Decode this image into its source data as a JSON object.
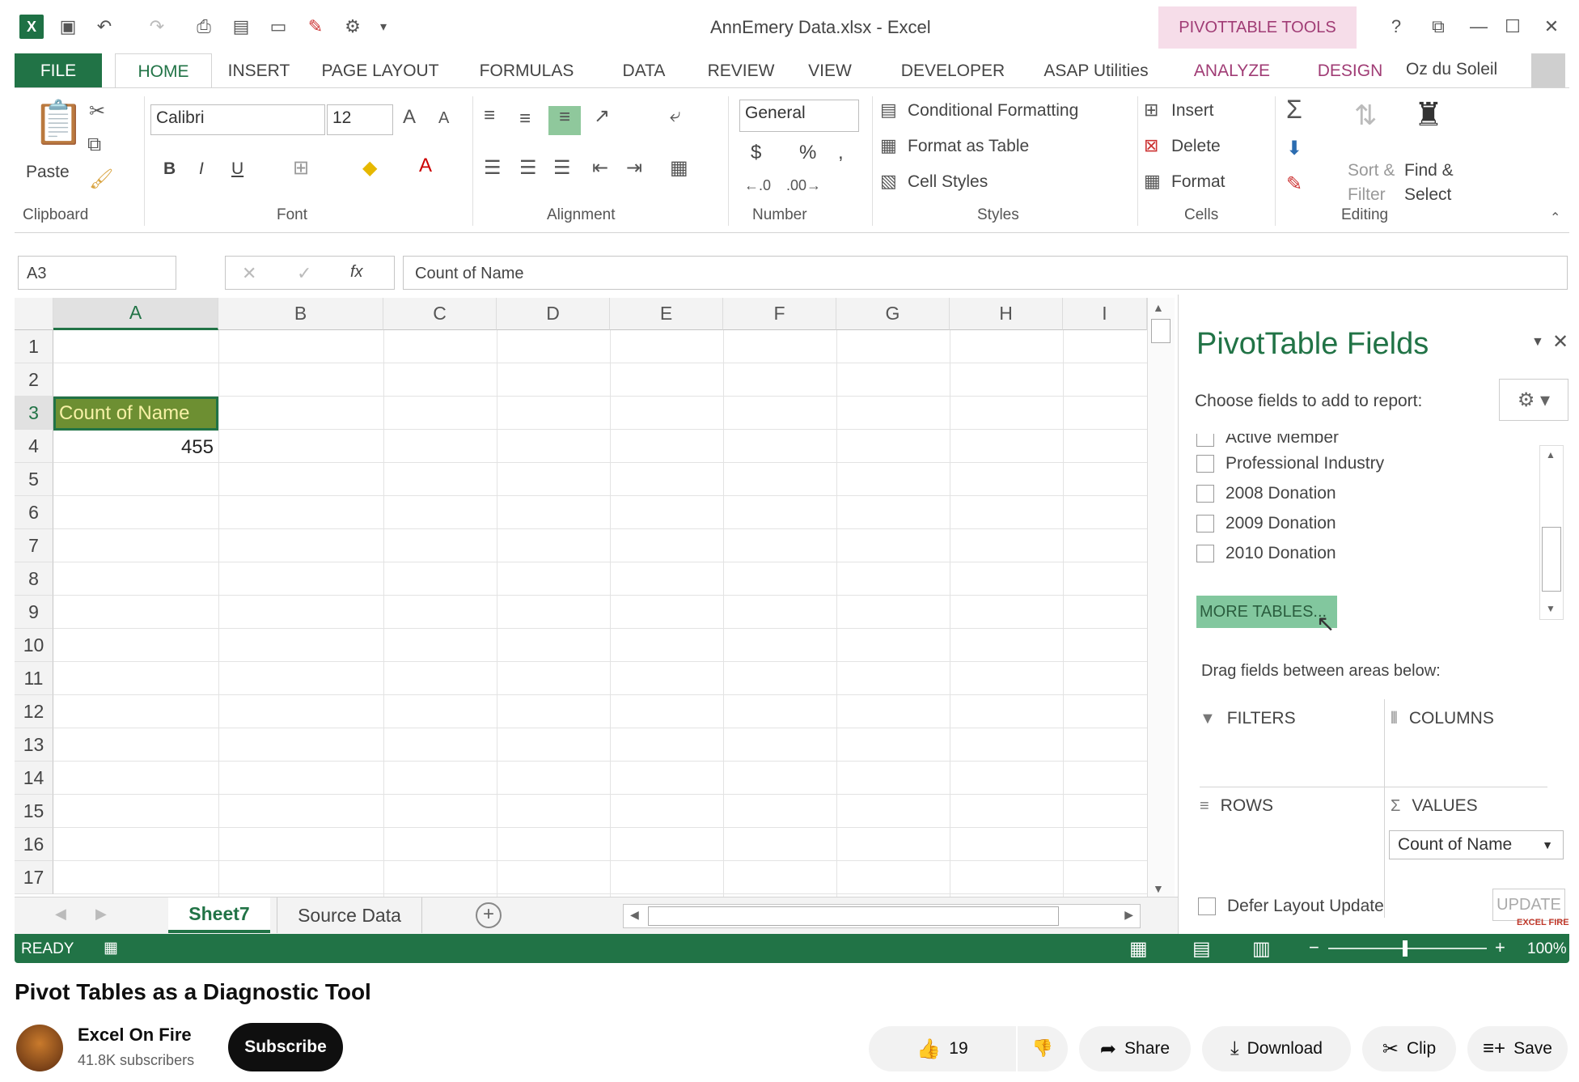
{
  "excel": {
    "window_title": "AnnEmery Data.xlsx - Excel",
    "contextual_tab_group": "PIVOTTABLE TOOLS",
    "help": "?",
    "tabs": [
      "FILE",
      "HOME",
      "INSERT",
      "PAGE LAYOUT",
      "FORMULAS",
      "DATA",
      "REVIEW",
      "VIEW",
      "DEVELOPER",
      "ASAP Utilities",
      "ANALYZE",
      "DESIGN"
    ],
    "user_name": "Oz du Soleil",
    "ribbon": {
      "clipboard": {
        "paste": "Paste",
        "label": "Clipboard"
      },
      "font": {
        "name": "Calibri",
        "size": "12",
        "bold": "B",
        "italic": "I",
        "underline": "U",
        "label": "Font"
      },
      "alignment": {
        "label": "Alignment"
      },
      "number": {
        "format": "General",
        "currency": "$",
        "percent": "%",
        "comma": ",",
        "label": "Number"
      },
      "styles": {
        "conditional_formatting": "Conditional Formatting",
        "format_as_table": "Format as Table",
        "cell_styles": "Cell Styles",
        "label": "Styles"
      },
      "cells": {
        "insert": "Insert",
        "delete": "Delete",
        "format": "Format",
        "label": "Cells"
      },
      "editing": {
        "sort_line1": "Sort &",
        "sort_line2": "Filter",
        "find_line1": "Find &",
        "find_line2": "Select",
        "label": "Editing"
      }
    },
    "name_box": "A3",
    "fx": "fx",
    "formula": "Count of Name",
    "columns": [
      "A",
      "B",
      "C",
      "D",
      "E",
      "F",
      "G",
      "H",
      "I"
    ],
    "rows": [
      "1",
      "2",
      "3",
      "4",
      "5",
      "6",
      "7",
      "8",
      "9",
      "10",
      "11",
      "12",
      "13",
      "14",
      "15",
      "16",
      "17"
    ],
    "cells": {
      "A3": "Count of Name",
      "A4": "455"
    },
    "sheets": [
      "Sheet7",
      "Source Data"
    ],
    "status": "READY",
    "zoom": "100%",
    "pivot_pane": {
      "title": "PivotTable Fields",
      "choose_label": "Choose fields to add to report:",
      "fields": [
        "Active Member",
        "Professional Industry",
        "2008 Donation",
        "2009 Donation",
        "2010 Donation"
      ],
      "more_tables": "MORE TABLES...",
      "drag_label": "Drag fields between areas below:",
      "areas": {
        "filters": "FILTERS",
        "columns": "COLUMNS",
        "rows": "ROWS",
        "values": "VALUES"
      },
      "values_item": "Count of Name",
      "defer_label": "Defer Layout Update",
      "update_label": "UPDATE"
    },
    "watermark": "EXCEL FIRE"
  },
  "youtube": {
    "video_title": "Pivot Tables as a Diagnostic Tool",
    "channel": "Excel On Fire",
    "subscribers": "41.8K subscribers",
    "subscribe": "Subscribe",
    "likes": "19",
    "share": "Share",
    "download": "Download",
    "clip": "Clip",
    "save": "Save",
    "more": "⋯"
  }
}
